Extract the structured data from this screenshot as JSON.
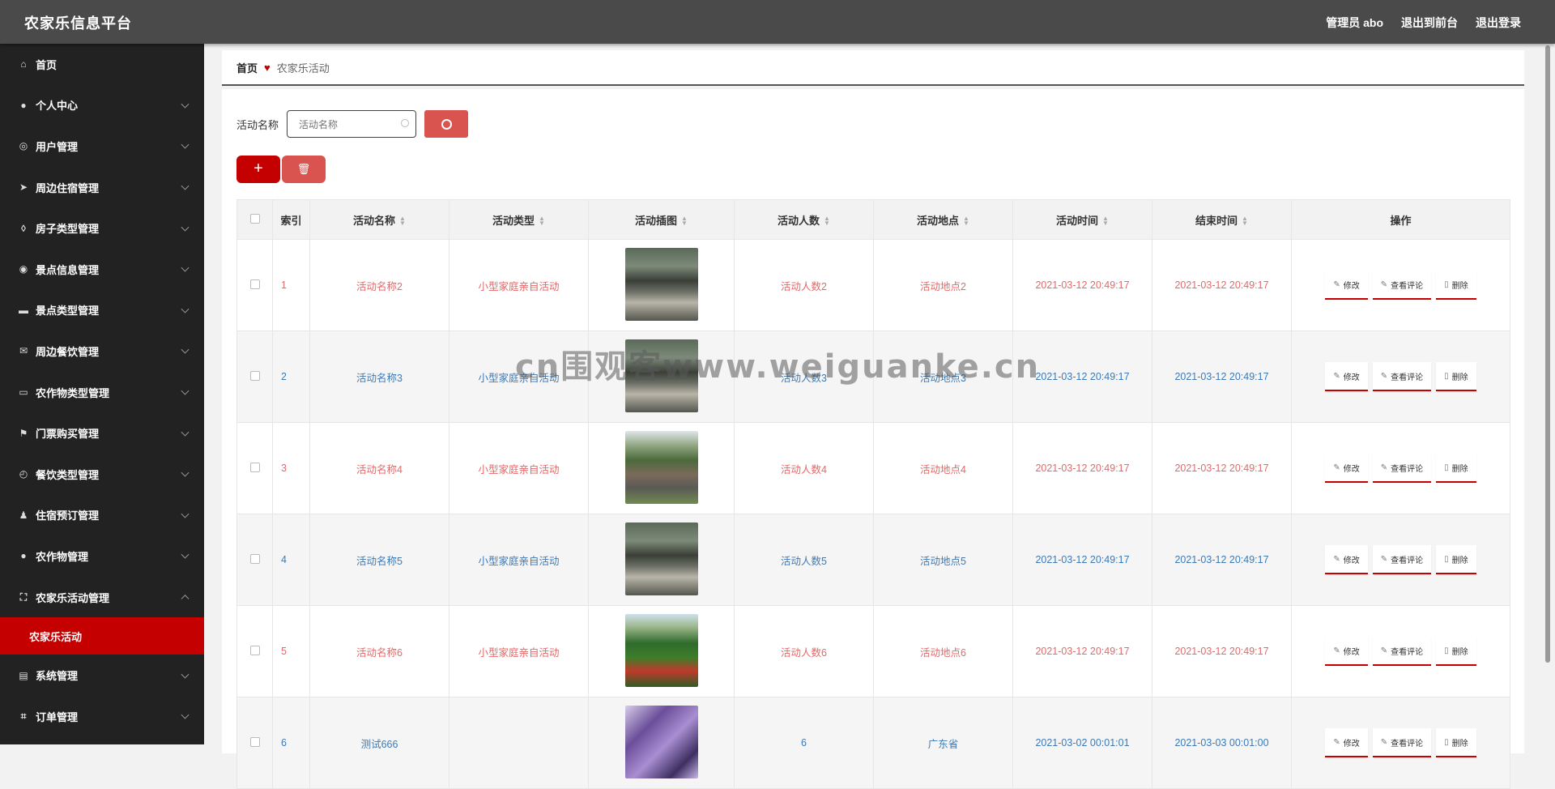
{
  "app": {
    "title": "农家乐信息平台"
  },
  "topnav": {
    "admin": "管理员 abo",
    "front": "退出到前台",
    "logout": "退出登录"
  },
  "sidebar": {
    "items": [
      {
        "label": "首页",
        "icon": "home-icon"
      },
      {
        "label": "个人中心",
        "icon": "user-icon"
      },
      {
        "label": "用户管理",
        "icon": "users-icon"
      },
      {
        "label": "周边住宿管理",
        "icon": "navigation-icon"
      },
      {
        "label": "房子类型管理",
        "icon": "tag-icon"
      },
      {
        "label": "景点信息管理",
        "icon": "compass-icon"
      },
      {
        "label": "景点类型管理",
        "icon": "briefcase-icon"
      },
      {
        "label": "周边餐饮管理",
        "icon": "mail-icon"
      },
      {
        "label": "农作物类型管理",
        "icon": "message-icon"
      },
      {
        "label": "门票购买管理",
        "icon": "flag-icon"
      },
      {
        "label": "餐饮类型管理",
        "icon": "clock-icon"
      },
      {
        "label": "住宿预订管理",
        "icon": "person-icon"
      },
      {
        "label": "农作物管理",
        "icon": "user-icon"
      },
      {
        "label": "农家乐活动管理",
        "icon": "expand-icon"
      },
      {
        "label": "系统管理",
        "icon": "window-icon"
      },
      {
        "label": "订单管理",
        "icon": "crop-icon"
      }
    ],
    "active_sub": "农家乐活动"
  },
  "breadcrumb": {
    "home": "首页",
    "current": "农家乐活动"
  },
  "search": {
    "label": "活动名称",
    "placeholder": "活动名称"
  },
  "table": {
    "headers": [
      "索引",
      "活动名称",
      "活动类型",
      "活动插图",
      "活动人数",
      "活动地点",
      "活动时间",
      "结束时间",
      "操作"
    ],
    "rows": [
      {
        "idx": "1",
        "name": "活动名称2",
        "type": "小型家庭亲自活动",
        "count": "活动人数2",
        "place": "活动地点2",
        "start": "2021-03-12 20:49:17",
        "end": "2021-03-12 20:49:17",
        "thumb": "thumb-shed"
      },
      {
        "idx": "2",
        "name": "活动名称3",
        "type": "小型家庭亲自活动",
        "count": "活动人数3",
        "place": "活动地点3",
        "start": "2021-03-12 20:49:17",
        "end": "2021-03-12 20:49:17",
        "thumb": "thumb-shed"
      },
      {
        "idx": "3",
        "name": "活动名称4",
        "type": "小型家庭亲自活动",
        "count": "活动人数4",
        "place": "活动地点4",
        "start": "2021-03-12 20:49:17",
        "end": "2021-03-12 20:49:17",
        "thumb": "thumb-group"
      },
      {
        "idx": "4",
        "name": "活动名称5",
        "type": "小型家庭亲自活动",
        "count": "活动人数5",
        "place": "活动地点5",
        "start": "2021-03-12 20:49:17",
        "end": "2021-03-12 20:49:17",
        "thumb": "thumb-shed"
      },
      {
        "idx": "5",
        "name": "活动名称6",
        "type": "小型家庭亲自活动",
        "count": "活动人数6",
        "place": "活动地点6",
        "start": "2021-03-12 20:49:17",
        "end": "2021-03-12 20:49:17",
        "thumb": "thumb-field"
      },
      {
        "idx": "6",
        "name": "测试666",
        "type": "",
        "count": "6",
        "place": "广东省",
        "start": "2021-03-02 00:01:01",
        "end": "2021-03-03 00:01:00",
        "thumb": "thumb-purple"
      }
    ],
    "ops": {
      "edit": "修改",
      "comments": "查看评论",
      "delete": "删除"
    }
  },
  "watermark": "cn围观客www.weiguanke.cn",
  "colors": {
    "accent": "#c40000",
    "sidebar": "#222222",
    "topbar": "#4a4a4a",
    "link_red": "#e06a6a",
    "link_blue": "#3c7ab6"
  }
}
